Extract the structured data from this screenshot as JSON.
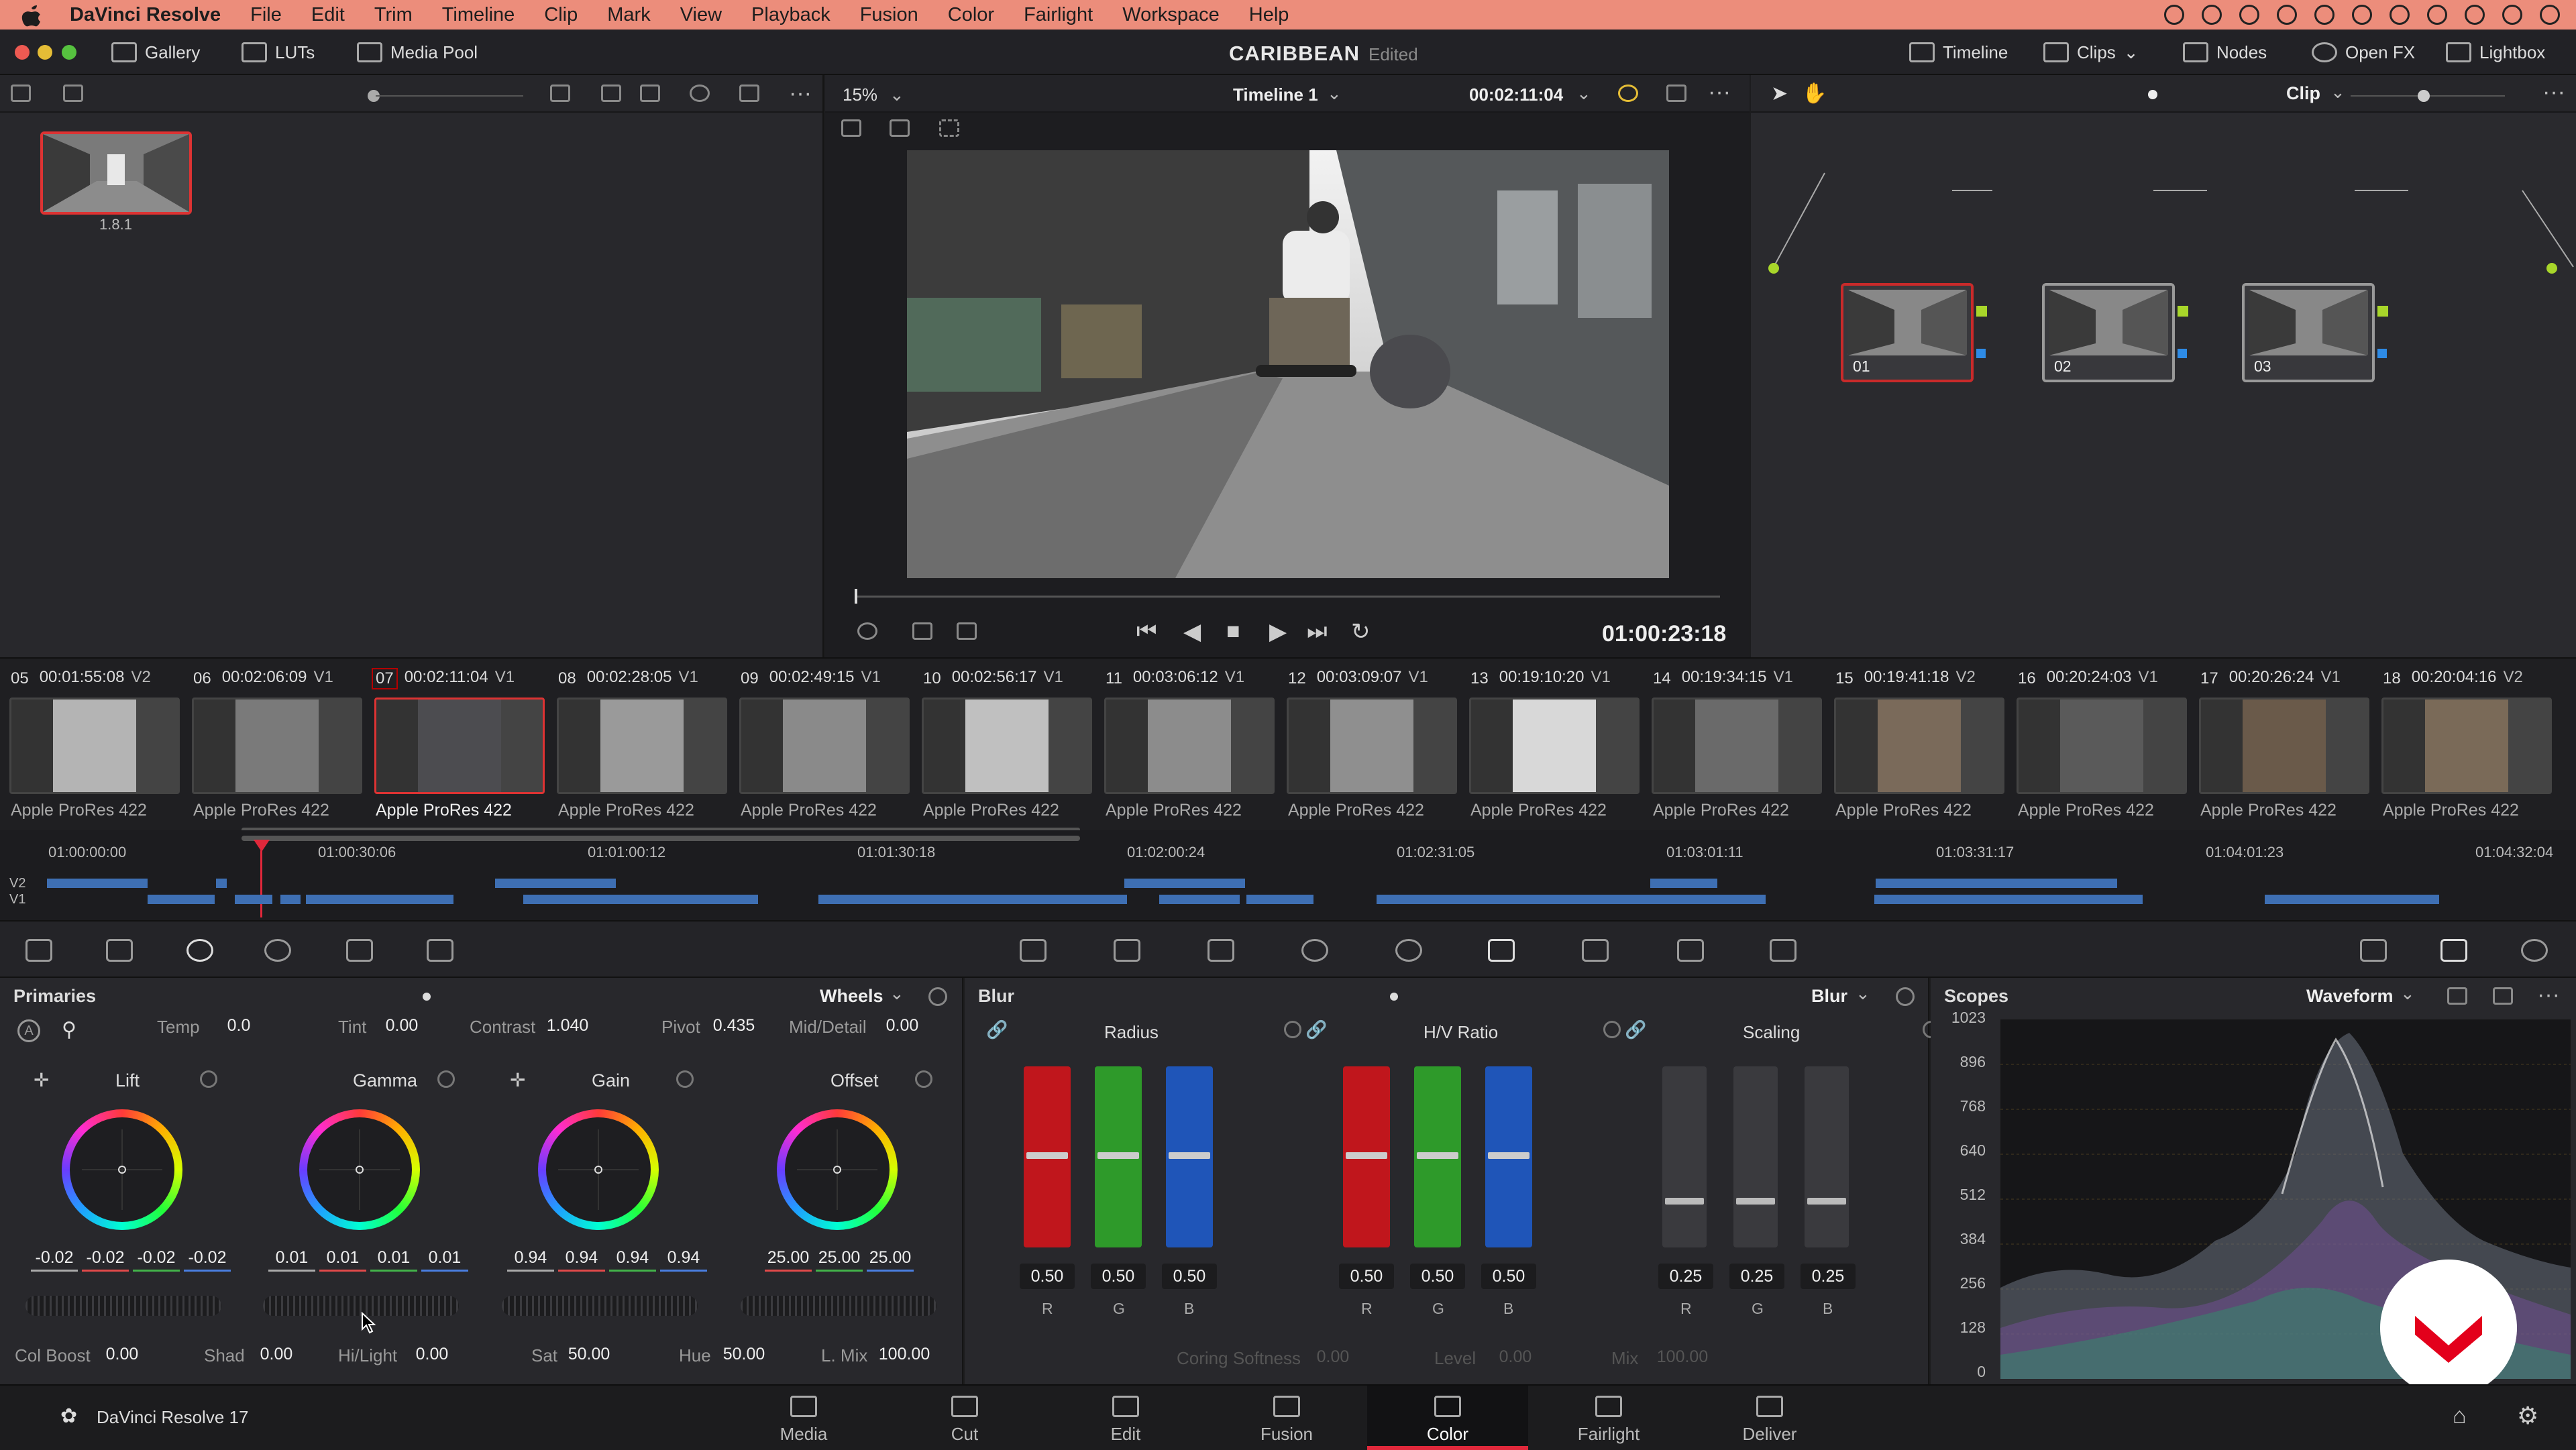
{
  "menubar": {
    "app": "DaVinci Resolve",
    "items": [
      "File",
      "Edit",
      "Trim",
      "Timeline",
      "Clip",
      "Mark",
      "View",
      "Playback",
      "Fusion",
      "Color",
      "Fairlight",
      "Workspace",
      "Help"
    ]
  },
  "topbar": {
    "left_tabs": [
      "Gallery",
      "LUTs",
      "Media Pool"
    ],
    "project_title": "CARIBBEAN",
    "project_state": "Edited",
    "right_tabs": [
      "Timeline",
      "Clips",
      "Nodes",
      "Open FX",
      "Lightbox"
    ]
  },
  "gallery": {
    "still_label": "1.8.1"
  },
  "viewer": {
    "zoom": "15%",
    "timeline_name": "Timeline 1",
    "timecode_top": "00:02:11:04",
    "timecode_playhead": "01:00:23:18"
  },
  "nodes": {
    "mode": "Clip",
    "node_labels": [
      "01",
      "02",
      "03"
    ]
  },
  "clips": [
    {
      "num": "05",
      "tc": "00:01:55:08",
      "track": "V2",
      "codec": "Apple ProRes 422"
    },
    {
      "num": "06",
      "tc": "00:02:06:09",
      "track": "V1",
      "codec": "Apple ProRes 422"
    },
    {
      "num": "07",
      "tc": "00:02:11:04",
      "track": "V1",
      "codec": "Apple ProRes 422",
      "selected": true
    },
    {
      "num": "08",
      "tc": "00:02:28:05",
      "track": "V1",
      "codec": "Apple ProRes 422"
    },
    {
      "num": "09",
      "tc": "00:02:49:15",
      "track": "V1",
      "codec": "Apple ProRes 422"
    },
    {
      "num": "10",
      "tc": "00:02:56:17",
      "track": "V1",
      "codec": "Apple ProRes 422"
    },
    {
      "num": "11",
      "tc": "00:03:06:12",
      "track": "V1",
      "codec": "Apple ProRes 422"
    },
    {
      "num": "12",
      "tc": "00:03:09:07",
      "track": "V1",
      "codec": "Apple ProRes 422"
    },
    {
      "num": "13",
      "tc": "00:19:10:20",
      "track": "V1",
      "codec": "Apple ProRes 422"
    },
    {
      "num": "14",
      "tc": "00:19:34:15",
      "track": "V1",
      "codec": "Apple ProRes 422"
    },
    {
      "num": "15",
      "tc": "00:19:41:18",
      "track": "V2",
      "codec": "Apple ProRes 422"
    },
    {
      "num": "16",
      "tc": "00:20:24:03",
      "track": "V1",
      "codec": "Apple ProRes 422"
    },
    {
      "num": "17",
      "tc": "00:20:26:24",
      "track": "V1",
      "codec": "Apple ProRes 422"
    },
    {
      "num": "18",
      "tc": "00:20:04:16",
      "track": "V2",
      "codec": "Apple ProRes 422"
    }
  ],
  "mini_timeline": {
    "ticks": [
      "01:00:00:00",
      "01:00:30:06",
      "01:01:00:12",
      "01:01:30:18",
      "01:02:00:24",
      "01:02:31:05",
      "01:03:01:11",
      "01:03:31:17",
      "01:04:01:23",
      "01:04:32:04"
    ],
    "tracks": [
      "V2",
      "V1"
    ]
  },
  "primaries": {
    "title": "Primaries",
    "mode": "Wheels",
    "temp_label": "Temp",
    "temp": "0.0",
    "tint_label": "Tint",
    "tint": "0.00",
    "contrast_label": "Contrast",
    "contrast": "1.040",
    "pivot_label": "Pivot",
    "pivot": "0.435",
    "middetail_label": "Mid/Detail",
    "middetail": "0.00",
    "wheels": [
      {
        "name": "Lift",
        "values": [
          "-0.02",
          "-0.02",
          "-0.02",
          "-0.02"
        ]
      },
      {
        "name": "Gamma",
        "values": [
          "0.01",
          "0.01",
          "0.01",
          "0.01"
        ]
      },
      {
        "name": "Gain",
        "values": [
          "0.94",
          "0.94",
          "0.94",
          "0.94"
        ]
      },
      {
        "name": "Offset",
        "values": [
          "25.00",
          "25.00",
          "25.00"
        ]
      }
    ],
    "colboost_label": "Col Boost",
    "colboost": "0.00",
    "shad_label": "Shad",
    "shad": "0.00",
    "hilight_label": "Hi/Light",
    "hilight": "0.00",
    "sat_label": "Sat",
    "sat": "50.00",
    "hue_label": "Hue",
    "hue": "50.00",
    "lmix_label": "L. Mix",
    "lmix": "100.00"
  },
  "blur": {
    "title": "Blur",
    "mode": "Blur",
    "groups": [
      {
        "name": "Radius",
        "values": [
          "0.50",
          "0.50",
          "0.50"
        ]
      },
      {
        "name": "H/V Ratio",
        "values": [
          "0.50",
          "0.50",
          "0.50"
        ]
      },
      {
        "name": "Scaling",
        "values": [
          "0.25",
          "0.25",
          "0.25"
        ]
      }
    ],
    "channels": [
      "R",
      "G",
      "B"
    ],
    "coring_label": "Coring Softness",
    "coring": "0.00",
    "level_label": "Level",
    "level": "0.00",
    "mix_label": "Mix",
    "mix": "100.00"
  },
  "scopes": {
    "title": "Scopes",
    "mode": "Waveform",
    "axis": [
      "1023",
      "896",
      "768",
      "640",
      "512",
      "384",
      "256",
      "128",
      "0"
    ]
  },
  "pages": [
    "Media",
    "Cut",
    "Edit",
    "Fusion",
    "Color",
    "Fairlight",
    "Deliver"
  ],
  "active_page": "Color",
  "footer_app": "DaVinci Resolve 17",
  "colors": {
    "accent": "#e0283b",
    "selection": "#c92a2a",
    "menubar": "#ec8d7b"
  }
}
